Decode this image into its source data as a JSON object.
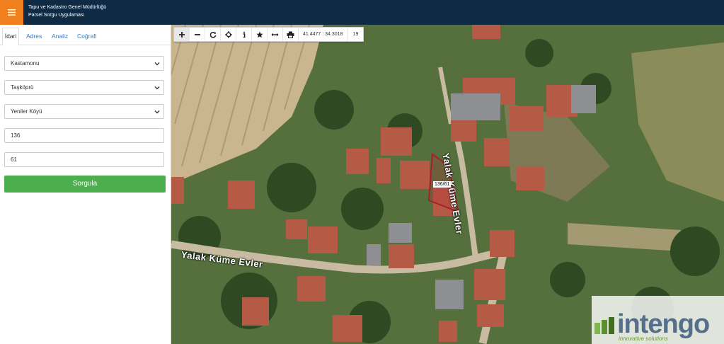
{
  "header": {
    "title_line1": "Tapu ve Kadastro Genel Müdürlüğü",
    "title_line2": "Parsel Sorgu Uygulaması",
    "menu_icon": "hamburger-icon",
    "accent_color": "#f07f1d",
    "bar_color": "#0f2a44"
  },
  "sidebar": {
    "tabs": [
      {
        "label": "İdari",
        "active": true
      },
      {
        "label": "Adres",
        "active": false
      },
      {
        "label": "Analiz",
        "active": false
      },
      {
        "label": "Coğrafi",
        "active": false
      }
    ],
    "form": {
      "province": "Kastamonu",
      "district": "Taşköprü",
      "neighborhood": "Yeniler Köyü",
      "block": "136",
      "parcel": "61"
    },
    "query_button": "Sorgula",
    "button_color": "#4cae4c"
  },
  "map": {
    "toolbar": {
      "icons": [
        "zoom-in-icon",
        "zoom-out-icon",
        "refresh-icon",
        "locate-icon",
        "info-icon",
        "star-icon",
        "measure-icon",
        "print-icon"
      ],
      "coordinates": "41.4477 : 34.3018",
      "zoom_level": "19"
    },
    "street_label_1": "Yalak Küme Evler",
    "street_label_2": "Yalak Küme Evler",
    "parcel_label": "136/61",
    "logo": {
      "name": "intengo",
      "tagline": "innovative solutions"
    }
  }
}
